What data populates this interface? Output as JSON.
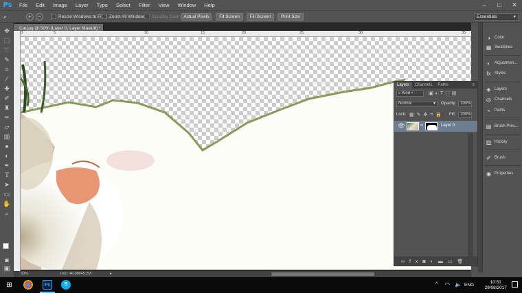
{
  "app": {
    "logo": "Ps",
    "menu": [
      "File",
      "Edit",
      "Image",
      "Layer",
      "Type",
      "Select",
      "Filter",
      "View",
      "Window",
      "Help"
    ]
  },
  "window": {
    "minimize": "–",
    "maximize": "□",
    "close": "✕"
  },
  "options_bar": {
    "resize_windows": "Resize Windows to Fit",
    "zoom_all": "Zoom All Windows",
    "scrubby_zoom": "Scrubby Zoom",
    "actual_pixels": "Actual Pixels",
    "fit_screen": "Fit Screen",
    "fill_screen": "Fill Screen",
    "print_size": "Print Size",
    "workspace": "Essentials"
  },
  "document": {
    "tab_title": "Cat.jpg @ 50% (Layer 0, Layer Mask/8) *",
    "tab_close": "×",
    "ruler_ticks": [
      "0",
      "5",
      "10",
      "15",
      "20",
      "25",
      "30",
      "35"
    ],
    "zoom": "50%",
    "doc_info": "Doc: 46.0M/45.2M"
  },
  "layers_panel": {
    "tabs": [
      "Layers",
      "Channels",
      "Paths"
    ],
    "kind": "Kind",
    "blend_mode": "Normal",
    "opacity_label": "Opacity:",
    "opacity": "100%",
    "lock_label": "Lock:",
    "fill_label": "Fill:",
    "fill": "100%",
    "layer_name": "Layer 0"
  },
  "right_panel": {
    "items": [
      "Color",
      "Swatches",
      "Adjustmen...",
      "Styles",
      "Layers",
      "Channels",
      "Paths",
      "Brush Pres...",
      "History",
      "Brush",
      "Properties"
    ]
  },
  "taskbar": {
    "lang": "ENG",
    "time": "10:51",
    "date": "29/08/2017",
    "ps_icon": "Ps",
    "skype_icon": "S"
  },
  "colors": {
    "ps_blue": "#31a8ff",
    "selected_layer": "#6d7e93"
  }
}
